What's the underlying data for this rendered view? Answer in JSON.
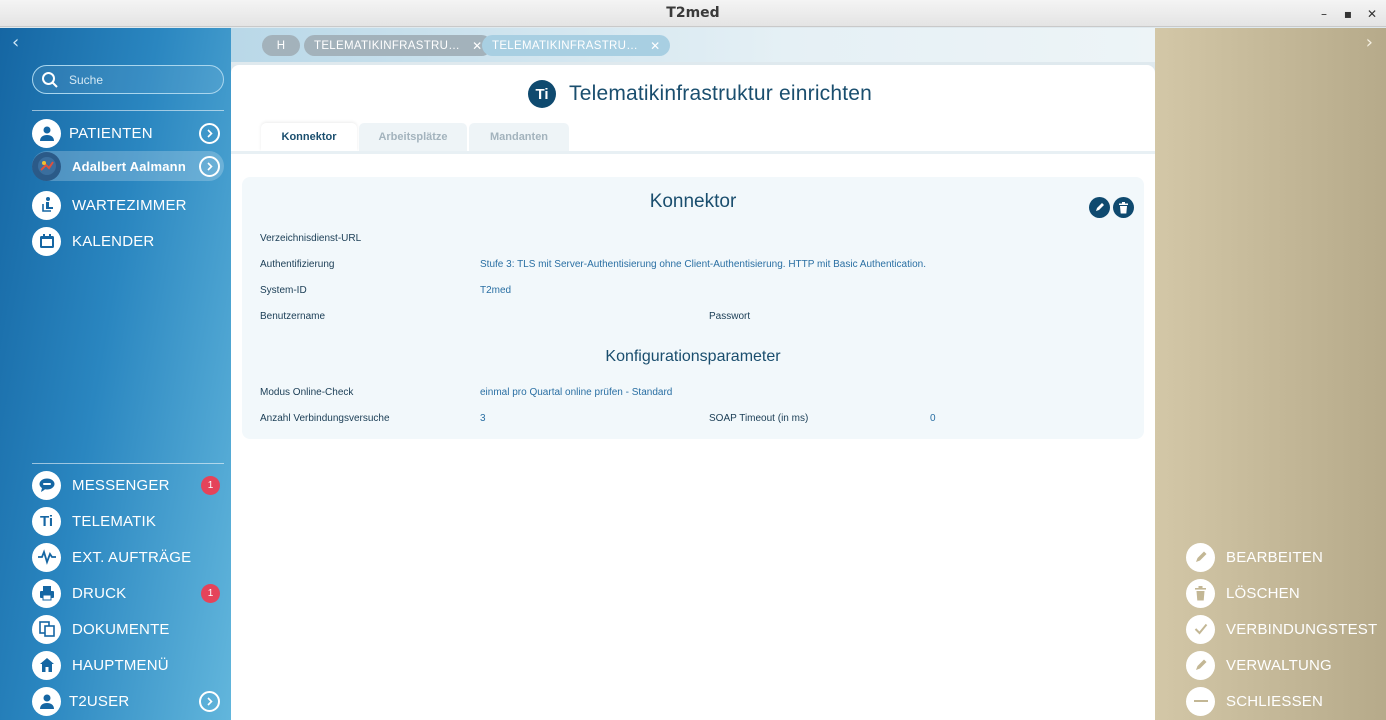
{
  "window": {
    "title": "T2med",
    "minimize": "–",
    "maximize": "▪",
    "close": "✕"
  },
  "left": {
    "collapse": "‹",
    "search_placeholder": "Suche",
    "top_items": [
      {
        "label": "PATIENTEN"
      },
      {
        "label": "Adalbert Aalmann"
      },
      {
        "label": "WARTEZIMMER"
      },
      {
        "label": "KALENDER"
      }
    ],
    "bottom_items": [
      {
        "label": "MESSENGER",
        "badge": "1"
      },
      {
        "label": "TELEMATIK",
        "icon_text": "Ti"
      },
      {
        "label": "EXT. AUFTRÄGE"
      },
      {
        "label": "DRUCK",
        "badge": "1"
      },
      {
        "label": "DOKUMENTE"
      },
      {
        "label": "HAUPTMENÜ"
      },
      {
        "label": "T2USER"
      }
    ]
  },
  "tabstrip": {
    "tabs": [
      {
        "label": "H"
      },
      {
        "label": "TELEMATIKINFRASTRU…",
        "close": "✕"
      },
      {
        "label": "TELEMATIKINFRASTRU…",
        "close": "✕"
      }
    ]
  },
  "main": {
    "icon_text": "Ti",
    "title": "Telematikinfrastruktur einrichten",
    "tabs": [
      "Konnektor",
      "Arbeitsplätze",
      "Mandanten"
    ],
    "panel": {
      "title": "Konnektor",
      "fields": {
        "verzeichnis_label": "Verzeichnisdienst-URL",
        "auth_label": "Authentifizierung",
        "auth_value": "Stufe 3: TLS mit Server-Authentisierung ohne Client-Authentisierung. HTTP mit Basic Authentication.",
        "sysid_label": "System-ID",
        "sysid_value": "T2med",
        "user_label": "Benutzername",
        "pass_label": "Passwort"
      },
      "config_title": "Konfigurationsparameter",
      "config": {
        "modus_label": "Modus Online-Check",
        "modus_value": "einmal pro Quartal online prüfen - Standard",
        "versuche_label": "Anzahl Verbindungsversuche",
        "versuche_value": "3",
        "soap_label": "SOAP Timeout (in ms)",
        "soap_value": "0"
      }
    }
  },
  "right": {
    "collapse": "›",
    "actions": [
      {
        "label": "BEARBEITEN"
      },
      {
        "label": "LÖSCHEN"
      },
      {
        "label": "VERBINDUNGSTEST"
      },
      {
        "label": "VERWALTUNG"
      },
      {
        "label": "SCHLIESSEN"
      }
    ]
  },
  "colors": {
    "primary_dark": "#0f4a6f",
    "badge": "#e5435a",
    "right_panel": "#c8bc9c"
  }
}
